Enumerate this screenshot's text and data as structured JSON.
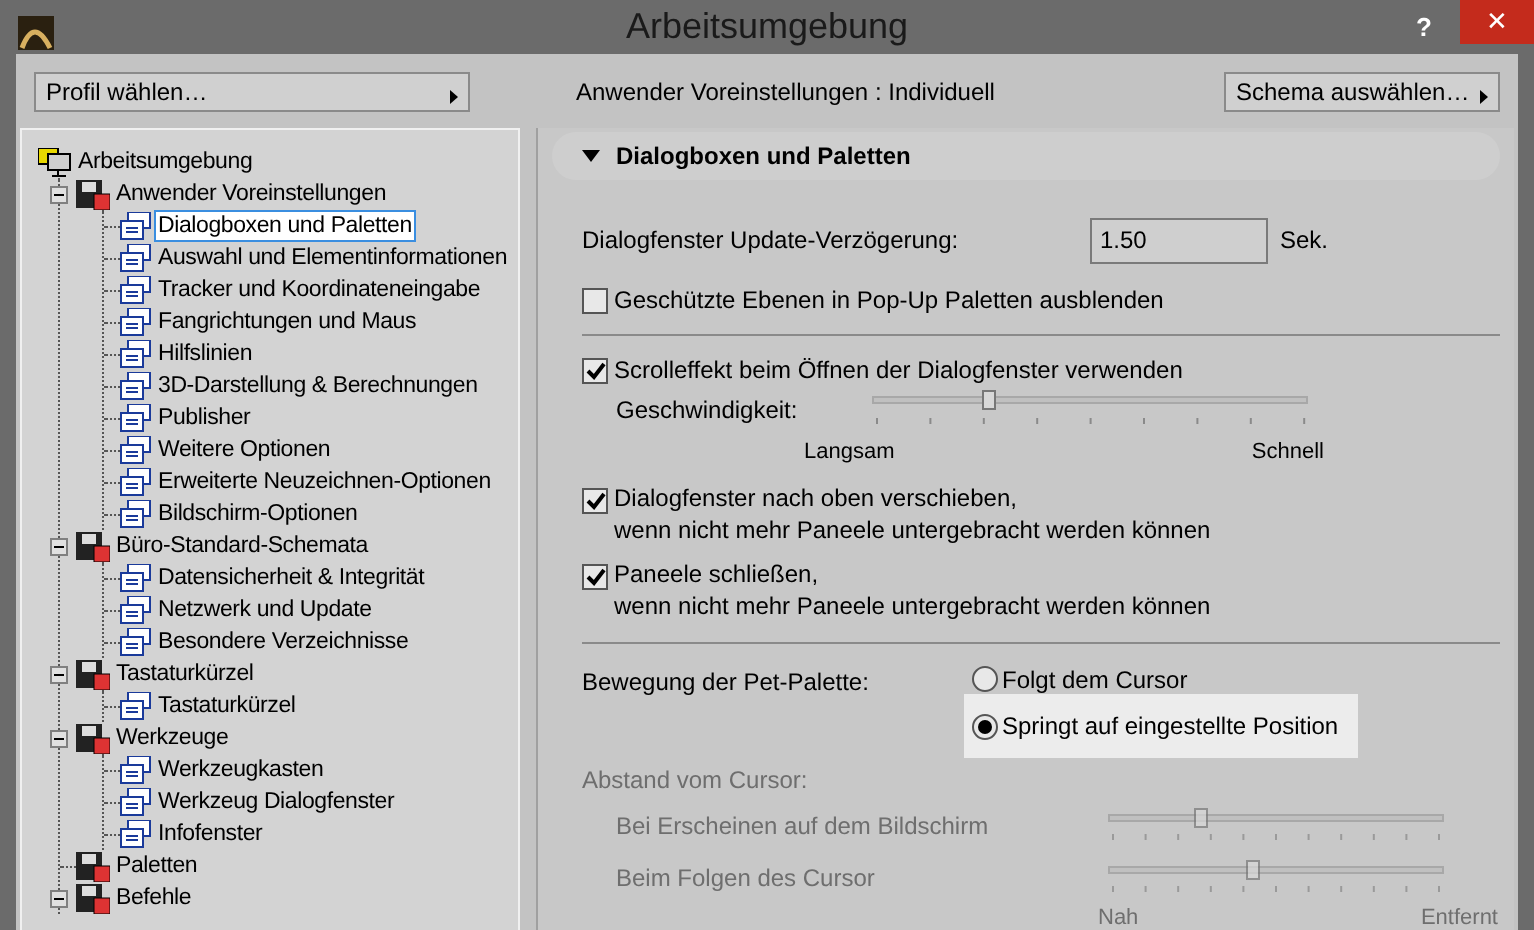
{
  "window": {
    "title": "Arbeitsumgebung",
    "help": "?",
    "close": "✕"
  },
  "toolbar": {
    "profile_button": "Profil wählen…",
    "status": "Anwender Voreinstellungen : Individuell",
    "scheme_button": "Schema auswählen…"
  },
  "tree": [
    {
      "label": "Arbeitsumgebung",
      "selected": false,
      "children": [
        {
          "label": "Anwender Voreinstellungen",
          "selected": false,
          "expanded": true,
          "children": [
            {
              "label": "Dialogboxen und Paletten",
              "selected": true
            },
            {
              "label": "Auswahl und Elementinformationen",
              "selected": false
            },
            {
              "label": "Tracker und Koordinateneingabe",
              "selected": false
            },
            {
              "label": "Fangrichtungen und Maus",
              "selected": false
            },
            {
              "label": "Hilfslinien",
              "selected": false
            },
            {
              "label": "3D-Darstellung & Berechnungen",
              "selected": false
            },
            {
              "label": "Publisher",
              "selected": false
            },
            {
              "label": "Weitere Optionen",
              "selected": false
            },
            {
              "label": "Erweiterte Neuzeichnen-Optionen",
              "selected": false
            },
            {
              "label": "Bildschirm-Optionen",
              "selected": false
            }
          ]
        },
        {
          "label": "Büro-Standard-Schemata",
          "selected": false,
          "expanded": true,
          "children": [
            {
              "label": "Datensicherheit & Integrität",
              "selected": false
            },
            {
              "label": "Netzwerk und Update",
              "selected": false
            },
            {
              "label": "Besondere Verzeichnisse",
              "selected": false
            }
          ]
        },
        {
          "label": "Tastaturkürzel",
          "selected": false,
          "expanded": true,
          "children": [
            {
              "label": "Tastaturkürzel",
              "selected": false
            }
          ]
        },
        {
          "label": "Werkzeuge",
          "selected": false,
          "expanded": true,
          "children": [
            {
              "label": "Werkzeugkasten",
              "selected": false
            },
            {
              "label": "Werkzeug Dialogfenster",
              "selected": false
            },
            {
              "label": "Infofenster",
              "selected": false
            }
          ]
        },
        {
          "label": "Paletten",
          "selected": false
        },
        {
          "label": "Befehle",
          "selected": false,
          "expanded": true
        }
      ]
    }
  ],
  "section": {
    "title": "Dialogboxen und Paletten",
    "expanded": true
  },
  "update_delay": {
    "label": "Dialogfenster Update-Verzögerung:",
    "value": "1.50",
    "unit": "Sek."
  },
  "hide_protected": {
    "label": "Geschützte Ebenen in Pop-Up Paletten ausblenden",
    "checked": false
  },
  "scroll_effect": {
    "label": "Scrolleffekt beim Öffnen der Dialogfenster verwenden",
    "checked": true,
    "speed": {
      "label": "Geschwindigkeit:",
      "level": 0.26,
      "min_label": "Langsam",
      "max_label": "Schnell"
    }
  },
  "panel_options": [
    {
      "lines": [
        "Dialogfenster nach oben verschieben,",
        "wenn nicht mehr Paneele untergebracht werden können"
      ],
      "checked": true
    },
    {
      "lines": [
        "Paneele schließen,",
        "wenn nicht mehr Paneele untergebracht werden können"
      ],
      "checked": true
    }
  ],
  "pet_palette": {
    "label": "Bewegung der Pet-Palette:",
    "options": [
      {
        "label": "Folgt dem Cursor",
        "selected": false
      },
      {
        "label": "Springt auf eingestellte Position",
        "selected": true
      }
    ]
  },
  "cursor_distance": {
    "label": "Abstand vom Cursor:",
    "disabled": true,
    "sliders": [
      {
        "label": "Bei Erscheinen auf dem Bildschirm",
        "level": 0.27
      },
      {
        "label": "Beim Folgen des Cursor",
        "level": 0.43
      }
    ],
    "min_label": "Nah",
    "max_label": "Entfernt"
  }
}
